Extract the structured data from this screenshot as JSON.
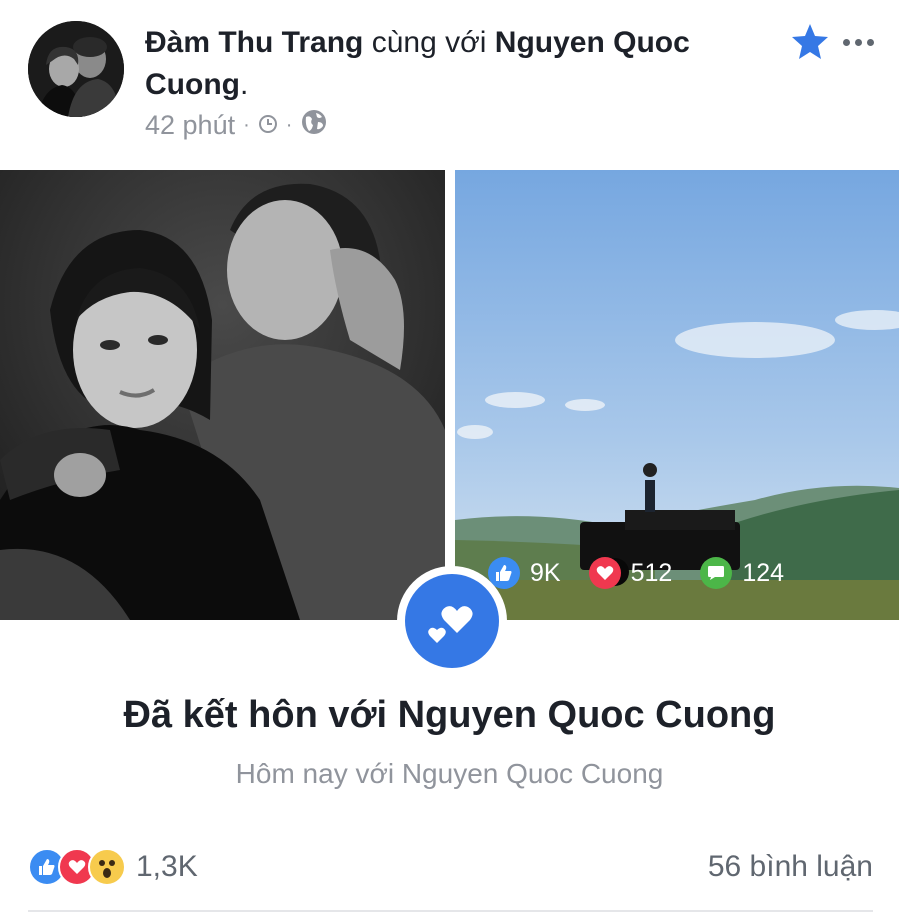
{
  "post": {
    "author": "Đàm Thu Trang",
    "with_text": "cùng với",
    "tagged": "Nguyen Quoc Cuong",
    "trailing": ".",
    "time": "42 phút",
    "separator": "·"
  },
  "photo_stats": {
    "likes": "9K",
    "hearts": "512",
    "comments": "124"
  },
  "event": {
    "title": "Đã kết hôn với Nguyen Quoc Cuong",
    "subtitle": "Hôm nay với Nguyen Quoc Cuong"
  },
  "footer": {
    "reaction_count": "1,3K",
    "comments_label": "56 bình luận"
  },
  "colors": {
    "brand_blue": "#3578e5",
    "like_blue": "#3b8cf2",
    "love_red": "#f0384f",
    "wow_yellow": "#f7cb4d",
    "comment_green": "#4cb648",
    "meta_gray": "#90949c"
  },
  "icons": {
    "star": "star-icon",
    "more": "more-icon",
    "clock": "clock-icon",
    "globe": "globe-icon",
    "like": "like-icon",
    "love": "love-icon",
    "wow": "wow-icon",
    "comment": "comment-icon",
    "life_event": "hearts-icon"
  }
}
